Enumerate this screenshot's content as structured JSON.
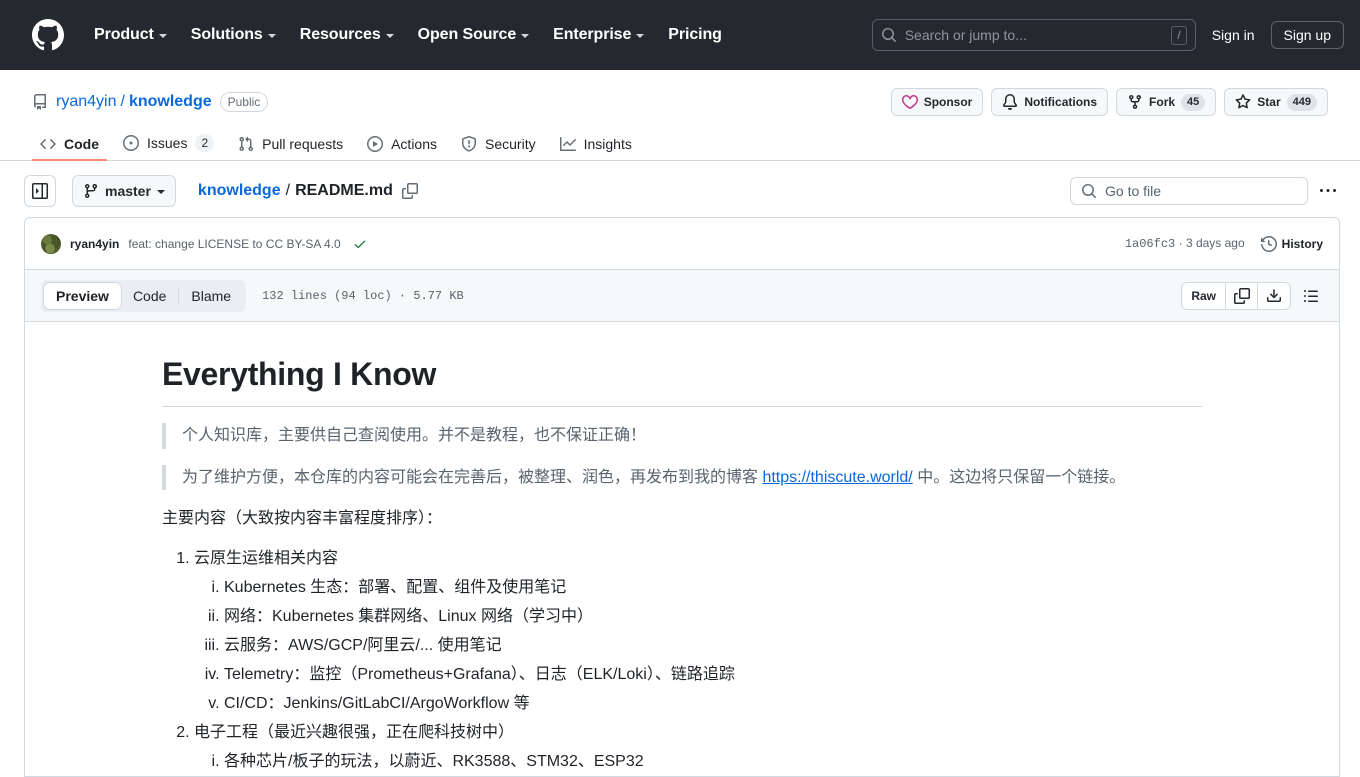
{
  "header": {
    "logo_icon": "github-mark-icon",
    "nav": [
      {
        "label": "Product",
        "has_caret": true
      },
      {
        "label": "Solutions",
        "has_caret": true
      },
      {
        "label": "Resources",
        "has_caret": true
      },
      {
        "label": "Open Source",
        "has_caret": true
      },
      {
        "label": "Enterprise",
        "has_caret": true
      },
      {
        "label": "Pricing",
        "has_caret": false
      }
    ],
    "search": {
      "placeholder": "Search or jump to...",
      "icon": "search-icon",
      "shortcut_key": "/"
    },
    "sign_in": "Sign in",
    "sign_up": "Sign up",
    "background": "#24292f"
  },
  "repo": {
    "icon": "repo-book-icon",
    "owner": "ryan4yin",
    "separator": "/",
    "name": "knowledge",
    "visibility": "Public",
    "actions": [
      {
        "id": "sponsor",
        "label": "Sponsor",
        "icon": "heart-icon"
      },
      {
        "id": "notifications",
        "label": "Notifications",
        "icon": "bell-icon"
      },
      {
        "id": "fork",
        "label": "Fork",
        "icon": "fork-icon",
        "count": "45"
      },
      {
        "id": "star",
        "label": "Star",
        "icon": "star-icon",
        "count": "449"
      }
    ]
  },
  "tabs": [
    {
      "id": "code",
      "label": "Code",
      "icon": "code-icon",
      "selected": true,
      "count": null
    },
    {
      "id": "issues",
      "label": "Issues",
      "icon": "issue-opened-icon",
      "selected": false,
      "count": "2"
    },
    {
      "id": "pull-requests",
      "label": "Pull requests",
      "icon": "git-pull-request-icon",
      "selected": false,
      "count": null
    },
    {
      "id": "actions",
      "label": "Actions",
      "icon": "play-icon",
      "selected": false,
      "count": null
    },
    {
      "id": "security",
      "label": "Security",
      "icon": "shield-icon",
      "selected": false,
      "count": null
    },
    {
      "id": "insights",
      "label": "Insights",
      "icon": "graph-icon",
      "selected": false,
      "count": null
    }
  ],
  "file_nav": {
    "sidebar_toggle_icon": "sidebar-expand-icon",
    "branch": "master",
    "branch_icon": "git-branch-icon",
    "breadcrumb_root": "knowledge",
    "breadcrumb_sep": "/",
    "breadcrumb_file": "README.md",
    "copy_path_icon": "copy-icon",
    "go_to_file_placeholder": "Go to file",
    "more_options_icon": "kebab-horizontal-icon"
  },
  "commit": {
    "author": "ryan4yin",
    "message": "feat: change LICENSE to CC BY-SA 4.0",
    "status_icon": "check-icon",
    "sha": "1a06fc3",
    "dot": "·",
    "time": "3 days ago",
    "history_label": "History",
    "history_icon": "history-icon"
  },
  "file_toolbar": {
    "views": [
      {
        "id": "preview",
        "label": "Preview",
        "selected": true
      },
      {
        "id": "code",
        "label": "Code",
        "selected": false
      },
      {
        "id": "blame",
        "label": "Blame",
        "selected": false
      }
    ],
    "meta": "132 lines (94 loc) · 5.77 KB",
    "raw_label": "Raw",
    "copy_icon": "copy-icon",
    "download_icon": "download-icon",
    "outline_icon": "list-unordered-icon"
  },
  "readme": {
    "title": "Everything I Know",
    "quotes": [
      {
        "text": "个人知识库，主要供自己查阅使用。并不是教程，也不保证正确！"
      },
      {
        "prefix": "为了维护方便，本仓库的内容可能会在完善后，被整理、润色，再发布到我的博客 ",
        "link": "https://thiscute.world/",
        "suffix": " 中。这边将只保留一个链接。"
      }
    ],
    "intro": "主要内容（大致按内容丰富程度排序）：",
    "sections": [
      {
        "title": "云原生运维相关内容",
        "items": [
          "Kubernetes 生态：部署、配置、组件及使用笔记",
          "网络：Kubernetes 集群网络、Linux 网络（学习中）",
          "云服务：AWS/GCP/阿里云/... 使用笔记",
          "Telemetry：监控（Prometheus+Grafana）、日志（ELK/Loki）、链路追踪",
          "CI/CD：Jenkins/GitLabCI/ArgoWorkflow 等"
        ]
      },
      {
        "title": "电子工程（最近兴趣很强，正在爬科技树中）",
        "items": [
          "各种芯片/板子的玩法，以蔚近、RK3588、STM32、ESP32"
        ]
      }
    ]
  },
  "colors": {
    "accent": "#0969da",
    "header_bg": "#24292f",
    "border": "#d1d9e0",
    "tab_underline": "#fd8c73",
    "muted": "#59636e",
    "success": "#1a7f37"
  }
}
